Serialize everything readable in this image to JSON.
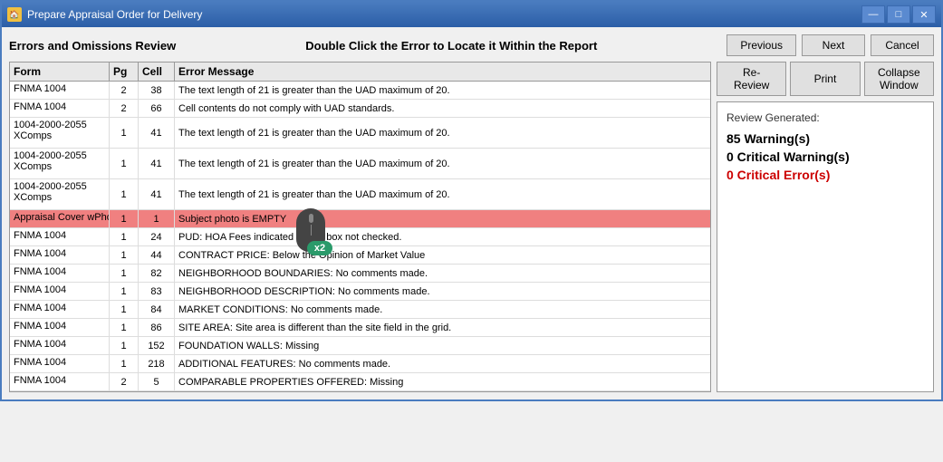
{
  "window": {
    "title": "Prepare Appraisal Order for Delivery",
    "icon": "A"
  },
  "titlebar": {
    "minimize_label": "—",
    "maximize_label": "□",
    "close_label": "✕"
  },
  "header": {
    "left_label": "Errors and Omissions Review",
    "center_label": "Double Click the Error to Locate it Within the Report",
    "previous_btn": "Previous",
    "next_btn": "Next",
    "cancel_btn": "Cancel"
  },
  "table": {
    "columns": [
      "Form",
      "Pg",
      "Cell",
      "Error Message"
    ],
    "rows": [
      {
        "form": "FNMA 1004",
        "pg": "2",
        "cell": "38",
        "message": "The text length of 21 is greater than the UAD maximum of 20.",
        "highlight": false
      },
      {
        "form": "FNMA 1004",
        "pg": "2",
        "cell": "66",
        "message": "Cell contents do not comply with UAD standards.",
        "highlight": false
      },
      {
        "form": "1004-2000-2055\nXComps",
        "pg": "1",
        "cell": "41",
        "message": "The text length of 21 is greater than the UAD maximum of 20.",
        "highlight": false
      },
      {
        "form": "1004-2000-2055\nXComps",
        "pg": "1",
        "cell": "41",
        "message": "The text length of 21 is greater than the UAD maximum of 20.",
        "highlight": false
      },
      {
        "form": "1004-2000-2055\nXComps",
        "pg": "1",
        "cell": "41",
        "message": "The text length of 21 is greater than the UAD maximum of 20.",
        "highlight": false
      },
      {
        "form": "Appraisal Cover wPhoto",
        "pg": "1",
        "cell": "1",
        "message": "Subject photo is EMPTY",
        "highlight": true
      },
      {
        "form": "FNMA 1004",
        "pg": "1",
        "cell": "24",
        "message": "PUD: HOA Fees indicated - PUD box not checked.",
        "highlight": false
      },
      {
        "form": "FNMA 1004",
        "pg": "1",
        "cell": "44",
        "message": "CONTRACT PRICE: Below the Opinion of Market Value",
        "highlight": false
      },
      {
        "form": "FNMA 1004",
        "pg": "1",
        "cell": "82",
        "message": "NEIGHBORHOOD BOUNDARIES: No comments made.",
        "highlight": false
      },
      {
        "form": "FNMA 1004",
        "pg": "1",
        "cell": "83",
        "message": "NEIGHBORHOOD DESCRIPTION: No comments made.",
        "highlight": false
      },
      {
        "form": "FNMA 1004",
        "pg": "1",
        "cell": "84",
        "message": "MARKET CONDITIONS: No comments made.",
        "highlight": false
      },
      {
        "form": "FNMA 1004",
        "pg": "1",
        "cell": "86",
        "message": "SITE AREA: Site area is different than the site field in the grid.",
        "highlight": false
      },
      {
        "form": "FNMA 1004",
        "pg": "1",
        "cell": "152",
        "message": "FOUNDATION WALLS: Missing",
        "highlight": false
      },
      {
        "form": "FNMA 1004",
        "pg": "1",
        "cell": "218",
        "message": "ADDITIONAL FEATURES: No comments made.",
        "highlight": false
      },
      {
        "form": "FNMA 1004",
        "pg": "2",
        "cell": "5",
        "message": "COMPARABLE PROPERTIES OFFERED: Missing",
        "highlight": false
      }
    ]
  },
  "side_panel": {
    "re_review_btn": "Re-Review",
    "print_btn": "Print",
    "collapse_window_btn": "Collapse Window",
    "review_generated_label": "Review Generated:",
    "warnings": "85 Warning(s)",
    "critical_warnings": "0 Critical Warning(s)",
    "critical_errors": "0 Critical Error(s)"
  },
  "mouse_badge": "x2"
}
